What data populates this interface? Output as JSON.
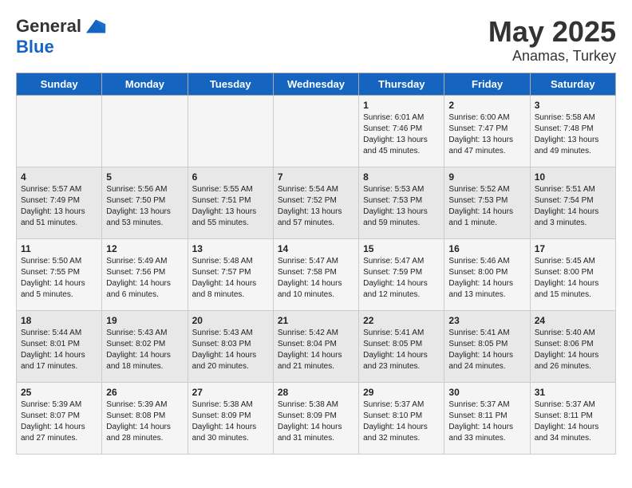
{
  "logo": {
    "general": "General",
    "blue": "Blue"
  },
  "title": {
    "month": "May 2025",
    "location": "Anamas, Turkey"
  },
  "weekdays": [
    "Sunday",
    "Monday",
    "Tuesday",
    "Wednesday",
    "Thursday",
    "Friday",
    "Saturday"
  ],
  "weeks": [
    [
      {
        "day": "",
        "info": ""
      },
      {
        "day": "",
        "info": ""
      },
      {
        "day": "",
        "info": ""
      },
      {
        "day": "",
        "info": ""
      },
      {
        "day": "1",
        "info": "Sunrise: 6:01 AM\nSunset: 7:46 PM\nDaylight: 13 hours\nand 45 minutes."
      },
      {
        "day": "2",
        "info": "Sunrise: 6:00 AM\nSunset: 7:47 PM\nDaylight: 13 hours\nand 47 minutes."
      },
      {
        "day": "3",
        "info": "Sunrise: 5:58 AM\nSunset: 7:48 PM\nDaylight: 13 hours\nand 49 minutes."
      }
    ],
    [
      {
        "day": "4",
        "info": "Sunrise: 5:57 AM\nSunset: 7:49 PM\nDaylight: 13 hours\nand 51 minutes."
      },
      {
        "day": "5",
        "info": "Sunrise: 5:56 AM\nSunset: 7:50 PM\nDaylight: 13 hours\nand 53 minutes."
      },
      {
        "day": "6",
        "info": "Sunrise: 5:55 AM\nSunset: 7:51 PM\nDaylight: 13 hours\nand 55 minutes."
      },
      {
        "day": "7",
        "info": "Sunrise: 5:54 AM\nSunset: 7:52 PM\nDaylight: 13 hours\nand 57 minutes."
      },
      {
        "day": "8",
        "info": "Sunrise: 5:53 AM\nSunset: 7:53 PM\nDaylight: 13 hours\nand 59 minutes."
      },
      {
        "day": "9",
        "info": "Sunrise: 5:52 AM\nSunset: 7:53 PM\nDaylight: 14 hours\nand 1 minute."
      },
      {
        "day": "10",
        "info": "Sunrise: 5:51 AM\nSunset: 7:54 PM\nDaylight: 14 hours\nand 3 minutes."
      }
    ],
    [
      {
        "day": "11",
        "info": "Sunrise: 5:50 AM\nSunset: 7:55 PM\nDaylight: 14 hours\nand 5 minutes."
      },
      {
        "day": "12",
        "info": "Sunrise: 5:49 AM\nSunset: 7:56 PM\nDaylight: 14 hours\nand 6 minutes."
      },
      {
        "day": "13",
        "info": "Sunrise: 5:48 AM\nSunset: 7:57 PM\nDaylight: 14 hours\nand 8 minutes."
      },
      {
        "day": "14",
        "info": "Sunrise: 5:47 AM\nSunset: 7:58 PM\nDaylight: 14 hours\nand 10 minutes."
      },
      {
        "day": "15",
        "info": "Sunrise: 5:47 AM\nSunset: 7:59 PM\nDaylight: 14 hours\nand 12 minutes."
      },
      {
        "day": "16",
        "info": "Sunrise: 5:46 AM\nSunset: 8:00 PM\nDaylight: 14 hours\nand 13 minutes."
      },
      {
        "day": "17",
        "info": "Sunrise: 5:45 AM\nSunset: 8:00 PM\nDaylight: 14 hours\nand 15 minutes."
      }
    ],
    [
      {
        "day": "18",
        "info": "Sunrise: 5:44 AM\nSunset: 8:01 PM\nDaylight: 14 hours\nand 17 minutes."
      },
      {
        "day": "19",
        "info": "Sunrise: 5:43 AM\nSunset: 8:02 PM\nDaylight: 14 hours\nand 18 minutes."
      },
      {
        "day": "20",
        "info": "Sunrise: 5:43 AM\nSunset: 8:03 PM\nDaylight: 14 hours\nand 20 minutes."
      },
      {
        "day": "21",
        "info": "Sunrise: 5:42 AM\nSunset: 8:04 PM\nDaylight: 14 hours\nand 21 minutes."
      },
      {
        "day": "22",
        "info": "Sunrise: 5:41 AM\nSunset: 8:05 PM\nDaylight: 14 hours\nand 23 minutes."
      },
      {
        "day": "23",
        "info": "Sunrise: 5:41 AM\nSunset: 8:05 PM\nDaylight: 14 hours\nand 24 minutes."
      },
      {
        "day": "24",
        "info": "Sunrise: 5:40 AM\nSunset: 8:06 PM\nDaylight: 14 hours\nand 26 minutes."
      }
    ],
    [
      {
        "day": "25",
        "info": "Sunrise: 5:39 AM\nSunset: 8:07 PM\nDaylight: 14 hours\nand 27 minutes."
      },
      {
        "day": "26",
        "info": "Sunrise: 5:39 AM\nSunset: 8:08 PM\nDaylight: 14 hours\nand 28 minutes."
      },
      {
        "day": "27",
        "info": "Sunrise: 5:38 AM\nSunset: 8:09 PM\nDaylight: 14 hours\nand 30 minutes."
      },
      {
        "day": "28",
        "info": "Sunrise: 5:38 AM\nSunset: 8:09 PM\nDaylight: 14 hours\nand 31 minutes."
      },
      {
        "day": "29",
        "info": "Sunrise: 5:37 AM\nSunset: 8:10 PM\nDaylight: 14 hours\nand 32 minutes."
      },
      {
        "day": "30",
        "info": "Sunrise: 5:37 AM\nSunset: 8:11 PM\nDaylight: 14 hours\nand 33 minutes."
      },
      {
        "day": "31",
        "info": "Sunrise: 5:37 AM\nSunset: 8:11 PM\nDaylight: 14 hours\nand 34 minutes."
      }
    ]
  ]
}
